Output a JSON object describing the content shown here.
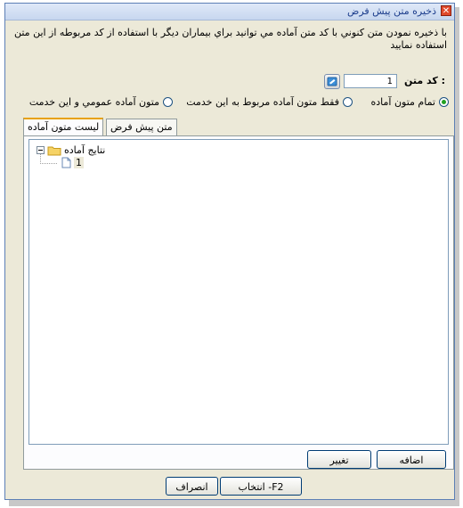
{
  "window": {
    "title": "ذخيره متن پيش فرض",
    "close_glyph": "✕"
  },
  "description": "با ذخيره نمودن متن كنوني با كد متن آماده مي توانيد براي بيماران ديگر با استفاده از كد مربوطه از اين متن استفاده نماييد",
  "code": {
    "label": "كد متن :",
    "value": "1",
    "button_icon": "note-pad-icon"
  },
  "radios": [
    {
      "label": "تمام متون آماده",
      "selected": true
    },
    {
      "label": "فقط متون آماده مربوط به اين خدمت",
      "selected": false
    },
    {
      "label": "متون آماده عمومي و اين خدمت",
      "selected": false
    }
  ],
  "tabs": [
    {
      "label": "ليست متون آماده",
      "active": true
    },
    {
      "label": "متن پيش فرض",
      "active": false
    }
  ],
  "tree": {
    "root_label": "نتايج آماده",
    "child_label": "1"
  },
  "panel_buttons": {
    "add": "اضافه",
    "change": "تغيير"
  },
  "footer_buttons": {
    "select": "F2- انتخاب",
    "cancel": "انصراف"
  },
  "colors": {
    "title_text": "#1c3d8c",
    "close": "#e04a2b",
    "tab_accent": "#e8a100",
    "radio_selected": "#21a121"
  }
}
